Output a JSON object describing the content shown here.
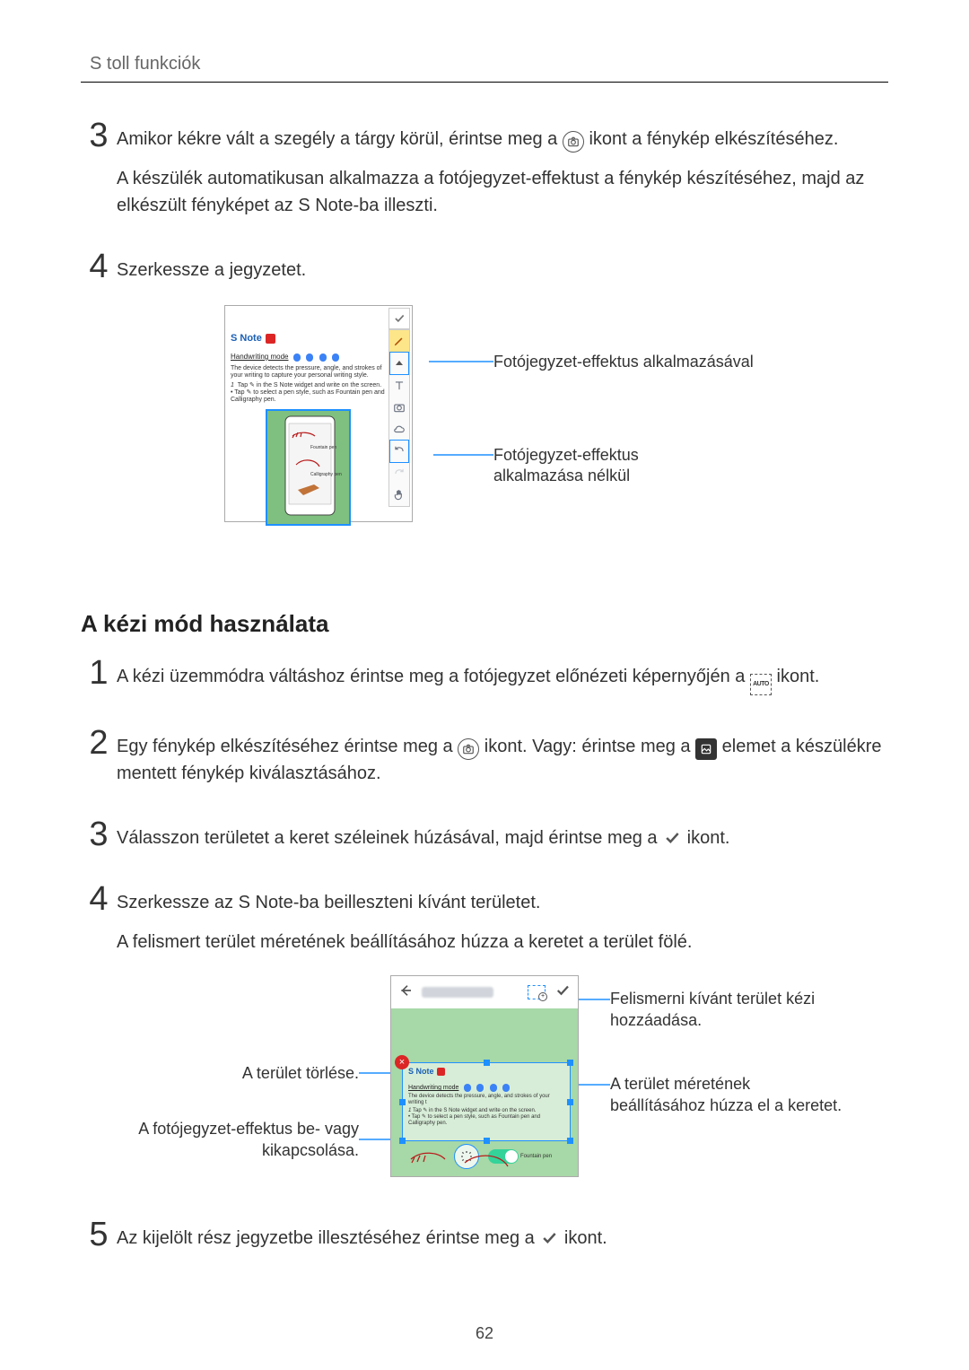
{
  "page_number": "62",
  "running_head": "S toll funkciók",
  "steps_top": {
    "s3": {
      "num": "3",
      "line1_a": "Amikor kékre vált a szegély a tárgy körül, érintse meg a ",
      "line1_b": " ikont a fénykép elkészítéséhez.",
      "line2": "A készülék automatikusan alkalmazza a fotójegyzet-effektust a fénykép készítéséhez, majd az elkészült fényképet az S Note-ba illeszti."
    },
    "s4": {
      "num": "4",
      "text": "Szerkessze a jegyzetet."
    }
  },
  "fig1": {
    "snote_title": "S Note",
    "mode_label": "Handwriting mode",
    "desc1": "The device detects the pressure, angle, and strokes of your writing to capture your personal writing style.",
    "desc2a": "Tap ✎ in the S Note widget and write on the screen.",
    "desc2b": "• Tap ✎ to select a pen style, such as Fountain pen and Calligraphy pen.",
    "callout_top": "Fotójegyzet-effektus alkalmazásával",
    "callout_bottom": "Fotójegyzet-effektus alkalmazása nélkül"
  },
  "section_heading": "A kézi mód használata",
  "steps_bottom": {
    "s1": {
      "num": "1",
      "a": "A kézi üzemmódra váltáshoz érintse meg a fotójegyzet előnézeti képernyőjén a ",
      "b": " ikont."
    },
    "s2": {
      "num": "2",
      "a": "Egy fénykép elkészítéséhez érintse meg a ",
      "b": " ikont. Vagy: érintse meg a ",
      "c": " elemet a készülékre mentett fénykép kiválasztásához."
    },
    "s3": {
      "num": "3",
      "a": "Válasszon területet a keret széleinek húzásával, majd érintse meg a ",
      "b": " ikont."
    },
    "s4": {
      "num": "4",
      "a": "Szerkessze az S Note-ba beilleszteni kívánt területet.",
      "b": "A felismert terület méretének beállításához húzza a keretet a terület fölé."
    },
    "s5": {
      "num": "5",
      "a": "Az kijelölt rész jegyzetbe illesztéséhez érintse meg a ",
      "b": " ikont."
    }
  },
  "fig2": {
    "callout_tr": "Felismerni kívánt terület kézi hozzáadása.",
    "callout_mr": "A terület méretének beállításához húzza el a keretet.",
    "callout_tl": "A terület törlése.",
    "callout_bl": "A fotójegyzet-effektus be- vagy kikapcsolása.",
    "snote_title": "S Note",
    "mode_label": "Handwriting mode",
    "desc1": "The device detects the pressure, angle, and strokes of your writing t",
    "desc2a": "Tap ✎ in the S Note widget and write on the screen.",
    "desc2b": "• Tap ✎ to select a pen style, such as Fountain pen and Calligraphy pen."
  },
  "icons": {
    "camera": "camera",
    "auto": "AUTO",
    "gallery": "gallery",
    "check": "check"
  }
}
